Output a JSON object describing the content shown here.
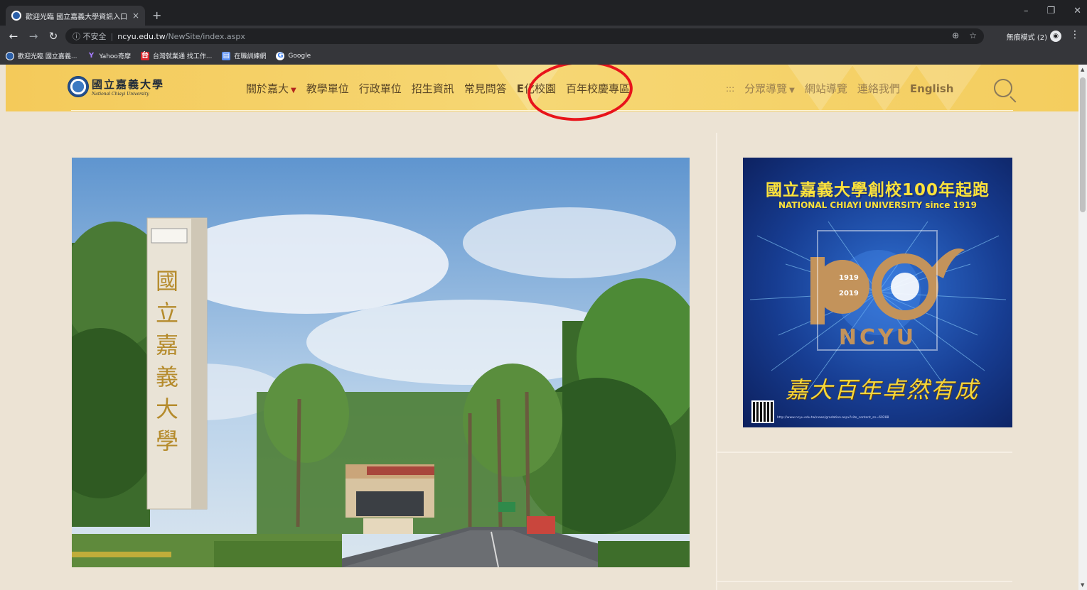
{
  "browser": {
    "tab_title": "歡迎光臨 國立嘉義大學資訊入口",
    "tab_close": "×",
    "new_tab": "+",
    "window_controls": [
      "–",
      "❐",
      "✕"
    ],
    "security_label": "ⓘ 不安全",
    "url_host": "ncyu.edu.tw",
    "url_path": "/NewSite/index.aspx",
    "incognito_label": "無痕模式 (2)",
    "bookmarks": [
      {
        "label": "歡迎光臨 國立嘉義...",
        "icon": "ncyu-favicon"
      },
      {
        "label": "Yahoo奇摩",
        "icon": "yahoo-icon"
      },
      {
        "label": "台灣就業通 找工作...",
        "icon": "taiwanjobs-icon"
      },
      {
        "label": "在職訓練網",
        "icon": "document-icon"
      },
      {
        "label": "Google",
        "icon": "google-icon"
      }
    ]
  },
  "site": {
    "logo_zh": "國立嘉義大學",
    "logo_en": "National Chiayi University",
    "nav": [
      {
        "label": "關於嘉大",
        "has_caret": true
      },
      {
        "label": "教學單位"
      },
      {
        "label": "行政單位"
      },
      {
        "label": "招生資訊"
      },
      {
        "label": "常見問答"
      },
      {
        "label_prefix": "E",
        "label": "化校園",
        "highlighted": true
      },
      {
        "label": "百年校慶專區"
      }
    ],
    "secondary_nav": [
      {
        "label": ":::"
      },
      {
        "label": "分眾導覽",
        "has_caret": true
      },
      {
        "label": "網站導覽"
      },
      {
        "label": "連絡我們"
      },
      {
        "label": "English"
      }
    ],
    "annotation_color": "#e8141b"
  },
  "banner": {
    "title": "國立嘉義大學創校100年起跑",
    "subtitle": "NATIONAL CHIAYI UNIVERSITY since 1919",
    "year_start": "1919",
    "year_end": "2019",
    "logo_text": "NCYU",
    "slogan": "嘉大百年卓然有成",
    "url": "http://www.ncyu.edu.tw/news/gradation.aspx?site_content_sn=60288"
  },
  "hero": {
    "tower_text": "國立嘉義大學"
  }
}
